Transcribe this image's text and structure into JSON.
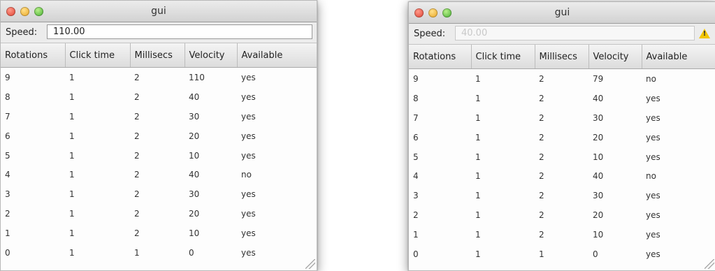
{
  "windows": [
    {
      "title": "gui",
      "speed_label": "Speed:",
      "speed_value": "110.00",
      "speed_enabled": true,
      "columns": [
        "Rotations",
        "Click time",
        "Millisecs",
        "Velocity",
        "Available"
      ],
      "rows": [
        [
          "9",
          "1",
          "2",
          "110",
          "yes"
        ],
        [
          "8",
          "1",
          "2",
          "40",
          "yes"
        ],
        [
          "7",
          "1",
          "2",
          "30",
          "yes"
        ],
        [
          "6",
          "1",
          "2",
          "20",
          "yes"
        ],
        [
          "5",
          "1",
          "2",
          "10",
          "yes"
        ],
        [
          "4",
          "1",
          "2",
          "40",
          "no"
        ],
        [
          "3",
          "1",
          "2",
          "30",
          "yes"
        ],
        [
          "2",
          "1",
          "2",
          "20",
          "yes"
        ],
        [
          "1",
          "1",
          "2",
          "10",
          "yes"
        ],
        [
          "0",
          "1",
          "1",
          "0",
          "yes"
        ]
      ]
    },
    {
      "title": "gui",
      "speed_label": "Speed:",
      "speed_value": "40.00",
      "speed_enabled": false,
      "warning_icon": "warning-triangle-icon",
      "warning_glyph": "!",
      "columns": [
        "Rotations",
        "Click time",
        "Millisecs",
        "Velocity",
        "Available"
      ],
      "rows": [
        [
          "9",
          "1",
          "2",
          "79",
          "no"
        ],
        [
          "8",
          "1",
          "2",
          "40",
          "yes"
        ],
        [
          "7",
          "1",
          "2",
          "30",
          "yes"
        ],
        [
          "6",
          "1",
          "2",
          "20",
          "yes"
        ],
        [
          "5",
          "1",
          "2",
          "10",
          "yes"
        ],
        [
          "4",
          "1",
          "2",
          "40",
          "no"
        ],
        [
          "3",
          "1",
          "2",
          "30",
          "yes"
        ],
        [
          "2",
          "1",
          "2",
          "20",
          "yes"
        ],
        [
          "1",
          "1",
          "2",
          "10",
          "yes"
        ],
        [
          "0",
          "1",
          "1",
          "0",
          "yes"
        ]
      ]
    }
  ]
}
